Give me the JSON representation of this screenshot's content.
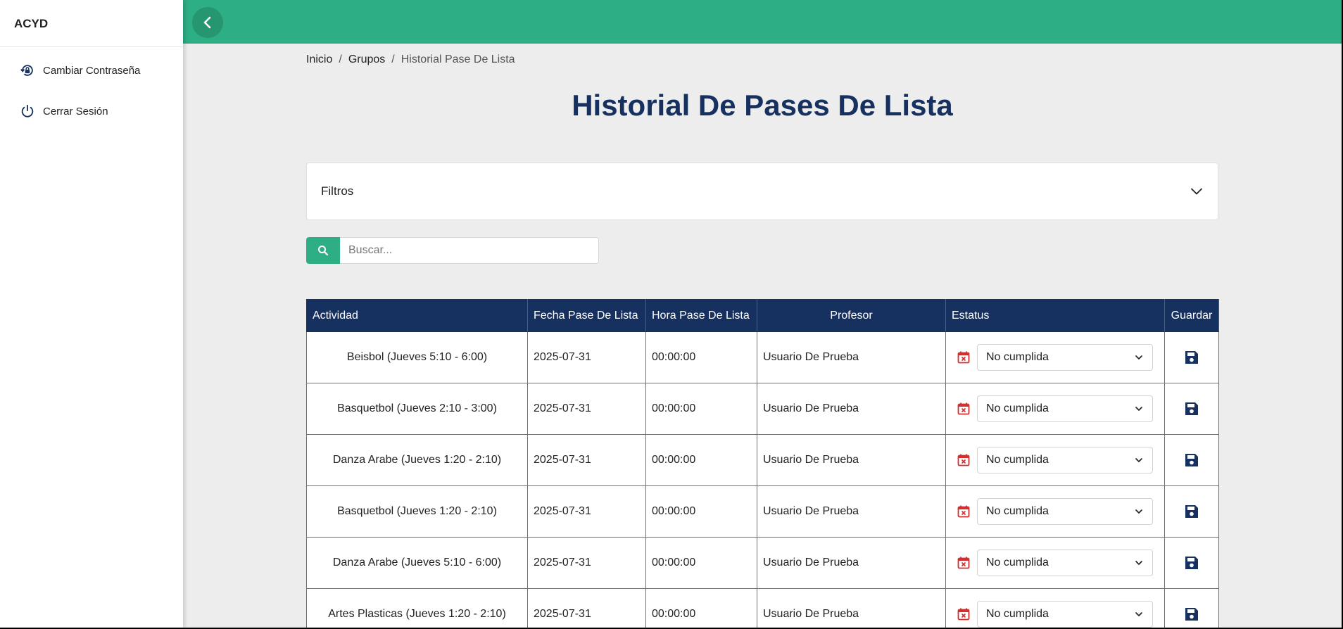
{
  "sidebar": {
    "brand": "ACYD",
    "items": [
      {
        "label": "Cambiar Contraseña",
        "icon": "lock-reset-icon"
      },
      {
        "label": "Cerrar Sesión",
        "icon": "power-icon"
      }
    ]
  },
  "topbar": {
    "color": "#2eae85",
    "back_icon": "chevron-left-icon"
  },
  "breadcrumb": {
    "items": [
      "Inicio",
      "Grupos",
      "Historial Pase De Lista"
    ],
    "separator": "/"
  },
  "page": {
    "title": "Historial De Pases De Lista"
  },
  "filters": {
    "label": "Filtros",
    "icon": "chevron-down-icon"
  },
  "search": {
    "placeholder": "Buscar...",
    "value": "",
    "icon": "search-icon"
  },
  "table": {
    "header_color": "#16305f",
    "columns": [
      "Actividad",
      "Fecha Pase De Lista",
      "Hora Pase De Lista",
      "Profesor",
      "Estatus",
      "Guardar"
    ],
    "rows": [
      {
        "actividad": "Beisbol (Jueves 5:10 - 6:00)",
        "fecha": "2025-07-31",
        "hora": "00:00:00",
        "profesor": "Usuario De Prueba",
        "estatus": "No cumplida"
      },
      {
        "actividad": "Basquetbol (Jueves 2:10 - 3:00)",
        "fecha": "2025-07-31",
        "hora": "00:00:00",
        "profesor": "Usuario De Prueba",
        "estatus": "No cumplida"
      },
      {
        "actividad": "Danza Arabe (Jueves 1:20 - 2:10)",
        "fecha": "2025-07-31",
        "hora": "00:00:00",
        "profesor": "Usuario De Prueba",
        "estatus": "No cumplida"
      },
      {
        "actividad": "Basquetbol (Jueves 1:20 - 2:10)",
        "fecha": "2025-07-31",
        "hora": "00:00:00",
        "profesor": "Usuario De Prueba",
        "estatus": "No cumplida"
      },
      {
        "actividad": "Danza Arabe (Jueves 5:10 - 6:00)",
        "fecha": "2025-07-31",
        "hora": "00:00:00",
        "profesor": "Usuario De Prueba",
        "estatus": "No cumplida"
      },
      {
        "actividad": "Artes Plasticas (Jueves 1:20 - 2:10)",
        "fecha": "2025-07-31",
        "hora": "00:00:00",
        "profesor": "Usuario De Prueba",
        "estatus": "No cumplida"
      }
    ],
    "status_icon": "calendar-x-icon",
    "status_icon_color": "#d32f2f",
    "save_icon": "floppy-disk-icon",
    "save_icon_color": "#16305f"
  }
}
